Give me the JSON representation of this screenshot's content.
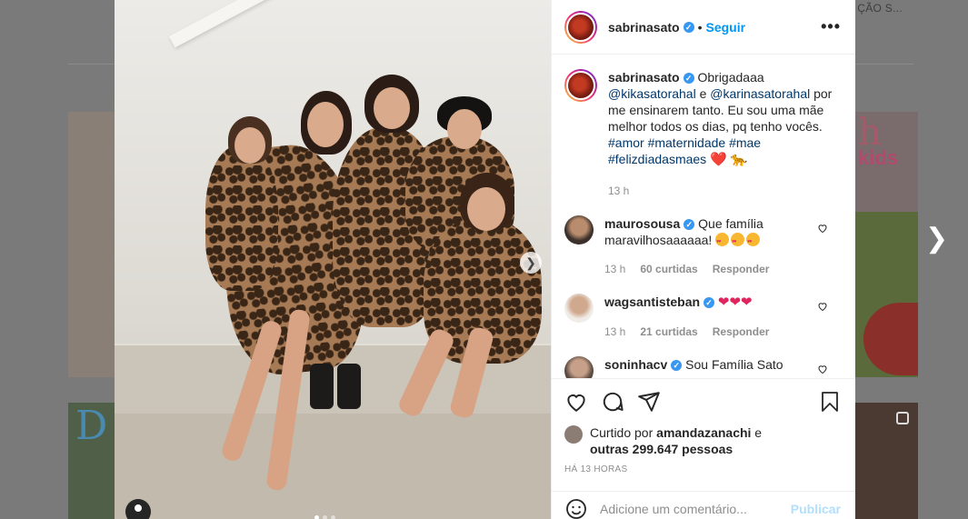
{
  "background": {
    "tab_text": "ÇÃO S..."
  },
  "post": {
    "author": "sabrinasato",
    "follow_label": "Seguir",
    "more_label": "•••",
    "caption": {
      "username": "sabrinasato",
      "text_1": "Obrigadaaa ",
      "mention_1": "@kikasatorahal",
      "text_2": " e ",
      "mention_2": "@karinasatorahal",
      "text_3": " por me ensinarem tanto. Eu sou uma mãe melhor todos os dias, pq tenho vocês. ",
      "hashtags": "#amor #maternidade #mae #felizdiadasmaes",
      "emoji": "❤️ 🐆",
      "time": "13 h"
    },
    "comments": [
      {
        "username": "maurosousa",
        "text": "Que família maravilhosaaaaaa!",
        "time": "13 h",
        "likes": "60 curtidas",
        "reply": "Responder"
      },
      {
        "username": "wagsantisteban",
        "text": "❤❤❤",
        "time": "13 h",
        "likes": "21 curtidas",
        "reply": "Responder"
      },
      {
        "username": "soninhacv",
        "text": "Sou Família Sato"
      }
    ],
    "likes": {
      "prefix": "Curtido por ",
      "user": "amandazanachi",
      "mid": " e",
      "others": "outras 299.647 pessoas"
    },
    "ago": "HÁ 13 HORAS",
    "add_comment_placeholder": "Adicione um comentário...",
    "publish_label": "Publicar"
  },
  "colors": {
    "link": "#00376b",
    "follow": "#0095f6",
    "verified": "#3897f0",
    "muted": "#8e8e8e"
  }
}
